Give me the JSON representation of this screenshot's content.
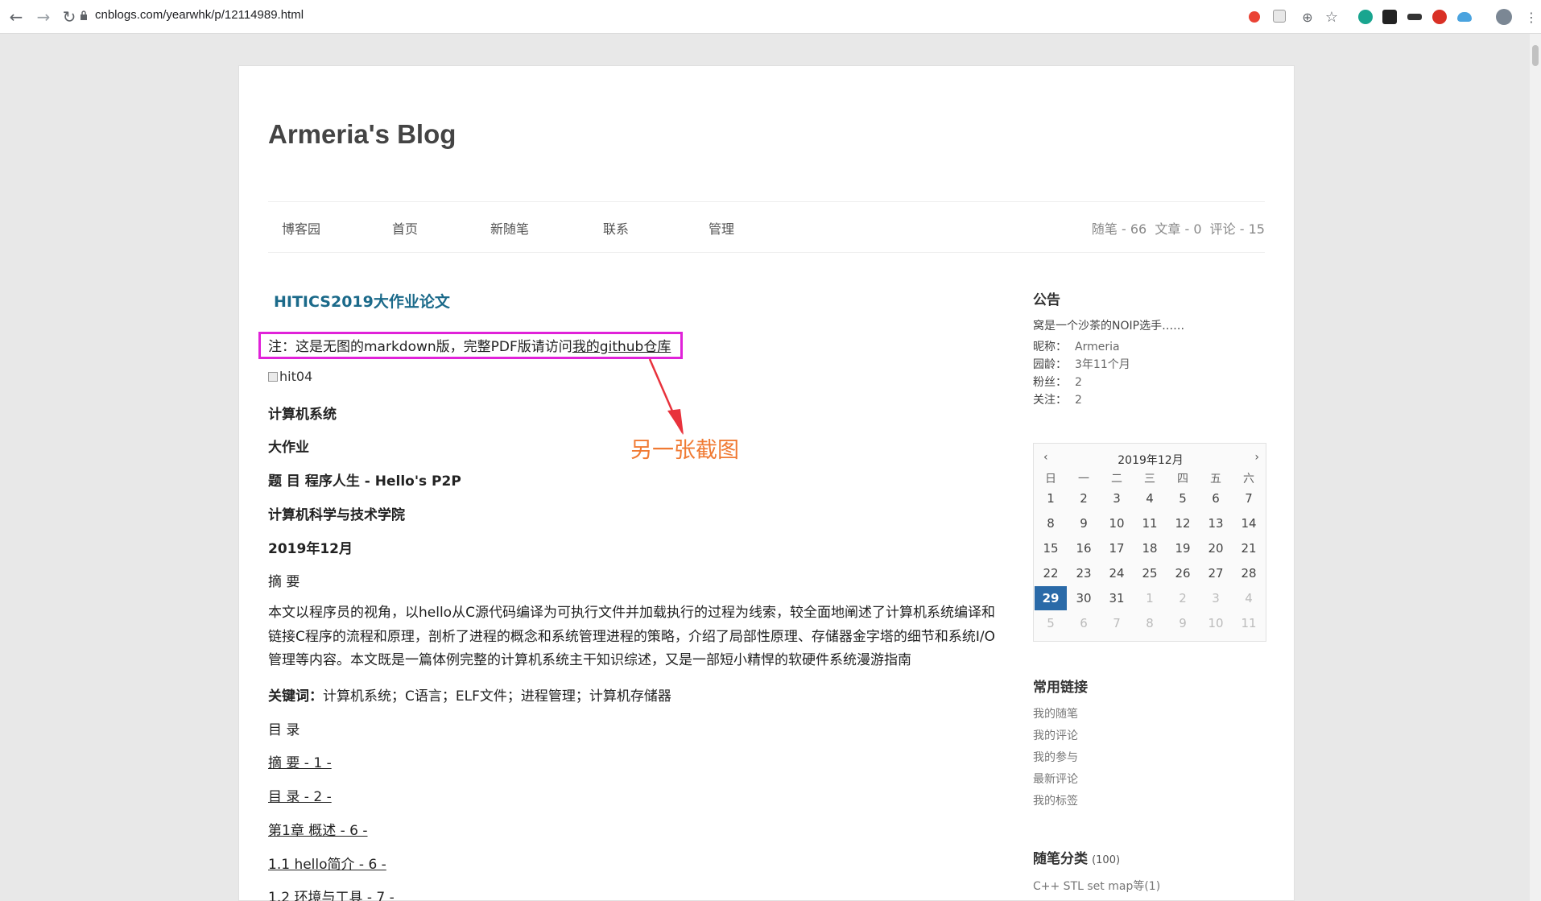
{
  "browser": {
    "url": "cnblogs.com/yearwhk/p/12114989.html"
  },
  "blog": {
    "title": "Armeria's Blog",
    "nav": [
      "博客园",
      "首页",
      "新随笔",
      "联系",
      "管理"
    ],
    "stats": "随笔 - 66  文章 - 0  评论 - 15"
  },
  "post": {
    "title": "HITICS2019大作业论文",
    "note_prefix": "注：这是无图的markdown版，完整PDF版请访问",
    "note_link": "我的github仓库",
    "image_alt": "hit04",
    "lines": [
      "计算机系统",
      "大作业",
      "题 目 程序人生 - Hello's P2P",
      "计算机科学与技术学院",
      "2019年12月",
      "摘 要"
    ],
    "abstract": "本文以程序员的视角，以hello从C源代码编译为可执行文件并加载执行的过程为线索，较全面地阐述了计算机系统编译和链接C程序的流程和原理，剖析了进程的概念和系统管理进程的策略，介绍了局部性原理、存储器金字塔的细节和系统I/O管理等内容。本文既是一篇体例完整的计算机系统主干知识综述，又是一部短小精悍的软硬件系统漫游指南",
    "keywords_label": "关键词：",
    "keywords": "计算机系统；C语言；ELF文件；进程管理；计算机存储器",
    "toc_title": "目 录",
    "toc": [
      "摘 要 - 1 -",
      "目 录 - 2 -",
      "第1章 概述 - 6 -",
      "1.1 hello简介 - 6 -",
      "1.2 环境与工具 - 7 -"
    ]
  },
  "annotation": {
    "text": "另一张截图",
    "box_color": "#e022d9",
    "arrow_color": "#e8323c",
    "text_color": "#f07a33"
  },
  "sidebar": {
    "notice_title": "公告",
    "notice_text": "窝是一个沙茶的NOIP选手……",
    "info": [
      {
        "label": "昵称：",
        "value": "Armeria"
      },
      {
        "label": "园龄：",
        "value": "3年11个月"
      },
      {
        "label": "粉丝：",
        "value": "2"
      },
      {
        "label": "关注：",
        "value": "2"
      }
    ],
    "calendar": {
      "prev": "‹",
      "next": "›",
      "title": "2019年12月",
      "weekdays": [
        "日",
        "一",
        "二",
        "三",
        "四",
        "五",
        "六"
      ],
      "days": [
        [
          "1",
          "2",
          "3",
          "4",
          "5",
          "6",
          "7"
        ],
        [
          "8",
          "9",
          "10",
          "11",
          "12",
          "13",
          "14"
        ],
        [
          "15",
          "16",
          "17",
          "18",
          "19",
          "20",
          "21"
        ],
        [
          "22",
          "23",
          "24",
          "25",
          "26",
          "27",
          "28"
        ],
        [
          "29",
          "30",
          "31",
          "1",
          "2",
          "3",
          "4"
        ],
        [
          "5",
          "6",
          "7",
          "8",
          "9",
          "10",
          "11"
        ]
      ],
      "today": "29"
    },
    "links_title": "常用链接",
    "links": [
      "我的随笔",
      "我的评论",
      "我的参与",
      "最新评论",
      "我的标签"
    ],
    "category_title": "随笔分类",
    "category_count": "(100)",
    "category_first": "C++ STL set map等(1)"
  }
}
